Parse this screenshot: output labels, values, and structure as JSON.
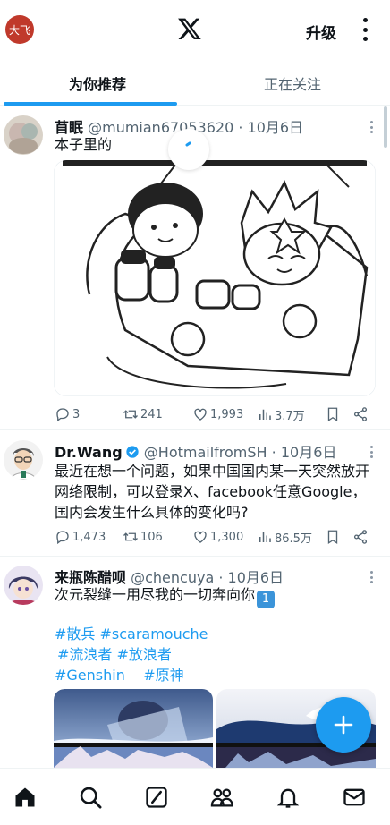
{
  "header": {
    "avatar_text": "大飞",
    "upgrade_label": "升级"
  },
  "tabs": [
    {
      "label": "为你推荐",
      "active": true
    },
    {
      "label": "正在关注",
      "active": false
    }
  ],
  "tweets": [
    {
      "name": "苜眠",
      "handle": "@mumian67053620",
      "date": "· 10月6日",
      "text": "本子里的",
      "stats": {
        "replies": "3",
        "retweets": "241",
        "likes": "1,993",
        "views": "3.7万"
      }
    },
    {
      "name": "Dr.Wang",
      "handle": "@HotmailfromSH",
      "date": "· 10月6日",
      "text": "最近在想一个问题，如果中国国内某一天突然放开网络限制，可以登录X、facebook任意Google，国内会发生什么具体的变化吗?",
      "stats": {
        "replies": "1,473",
        "retweets": "106",
        "likes": "1,300",
        "views": "86.5万"
      }
    },
    {
      "name": "来瓶陈醋呗",
      "handle": "@chencuya",
      "date": "· 10月6日",
      "text": "次元裂缝一用尽我的一切奔向你",
      "emoji": "1️⃣",
      "hashtags": [
        "#散兵 #scaramouche",
        "#流浪者 #放浪者",
        "#Genshin    #原神"
      ]
    }
  ],
  "colors": {
    "accent": "#1d9bf0",
    "text": "#0f1419",
    "muted": "#536471"
  }
}
